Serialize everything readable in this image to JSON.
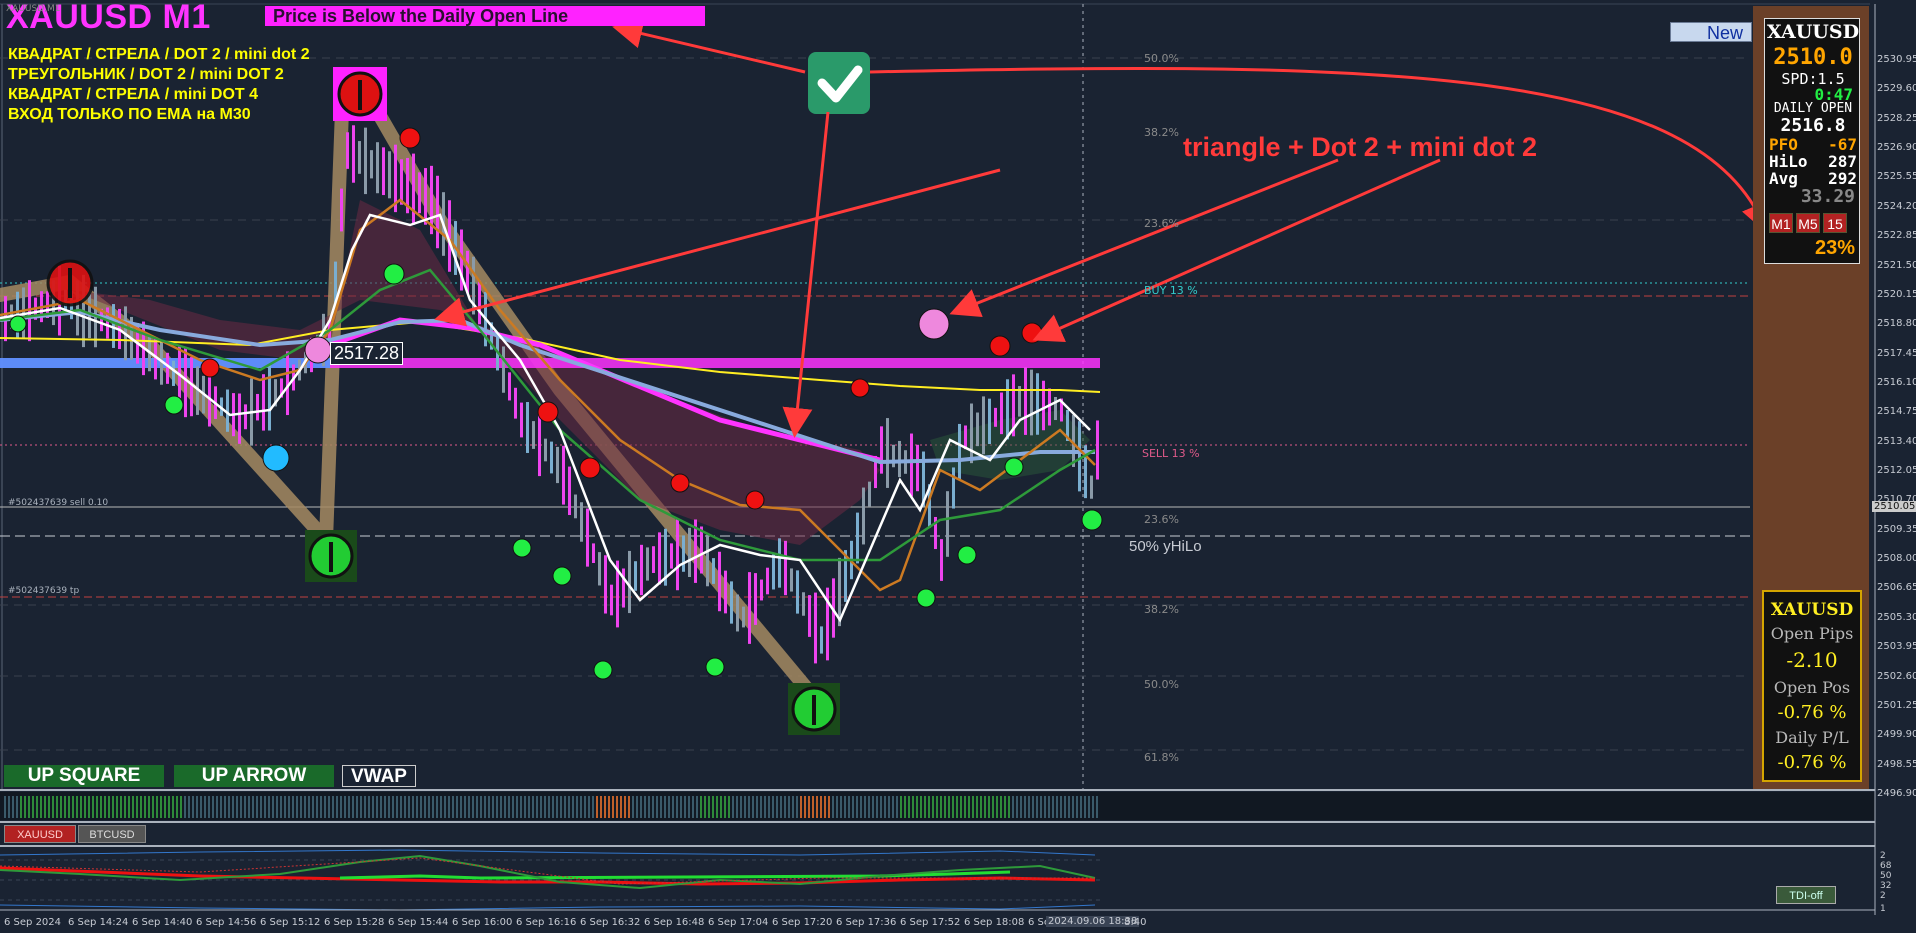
{
  "header": {
    "title": "XAUUSD M1",
    "banner": "Price is Below the Daily Open Line",
    "small_symbol": "XAUUSD,M1"
  },
  "notes": [
    "КВАДРАТ / СТРЕЛА / DOT 2 / mini dot 2",
    "ТРЕУГОЛЬНИК / DOT 2 / mini DOT 2",
    "КВАДРАТ / СТРЕЛА /  mini DOT 4",
    "ВХОД ТОЛЬКО ПО ЕМА на  M30"
  ],
  "annotation": "triangle + Dot 2 + mini dot 2",
  "new_button": "New",
  "current_price_tag": "2517.28",
  "order_labels": {
    "sell": "#502437639 sell 0.10",
    "tp": "#502437639 tp"
  },
  "levels": {
    "buy": "BUY 13 %",
    "sell": "SELL 13 %",
    "yhilo": "50% yHiLo"
  },
  "fib_labels": [
    "50.0%",
    "38.2%",
    "23.6%",
    "23.6%",
    "38.2%",
    "50.0%",
    "61.8%"
  ],
  "bottom_buttons": [
    "UP SQUARE",
    "UP ARROW",
    "VWAP"
  ],
  "info_panel": {
    "symbol": "XAUUSD",
    "price": "2510.0",
    "spread": "SPD:1.5",
    "timer": "0:47",
    "daily_open_label": "DAILY OPEN",
    "daily_open": "2516.8",
    "pfo_label": "PFO",
    "pfo": "-67",
    "hilo_label": "HiLo",
    "hilo": "287",
    "avg_label": "Avg",
    "avg": "292",
    "value": "33.29",
    "timeframes": [
      "M1",
      "M5",
      "15"
    ],
    "percent": "23%"
  },
  "position_panel": {
    "symbol": "XAUUSD",
    "open_pips_label": "Open Pips",
    "open_pips": "-2.10",
    "open_pos_label": "Open Pos",
    "open_pos": "-0.76 %",
    "daily_pl_label": "Daily P/L",
    "daily_pl": "-0.76 %"
  },
  "price_axis": [
    "2530.95",
    "2529.60",
    "2528.25",
    "2526.90",
    "2525.55",
    "2524.20",
    "2522.85",
    "2521.50",
    "2520.15",
    "2518.80",
    "2517.45",
    "2516.10",
    "2514.75",
    "2513.40",
    "2512.05",
    "2510.70",
    "2509.35",
    "2508.00",
    "2506.65",
    "2505.30",
    "2503.95",
    "2502.60",
    "2501.25",
    "2499.90",
    "2498.55",
    "2496.90"
  ],
  "current_axis_price": "2510.05",
  "indicator_axis": [
    "2",
    "68",
    "50",
    "32",
    "2",
    "1"
  ],
  "time_axis": [
    "6 Sep 2024",
    "6 Sep 14:24",
    "6 Sep 14:40",
    "6 Sep 14:56",
    "6 Sep 15:12",
    "6 Sep 15:28",
    "6 Sep 15:44",
    "6 Sep 16:00",
    "6 Sep 16:16",
    "6 Sep 16:32",
    "6 Sep 16:48",
    "6 Sep 17:04",
    "6 Sep 17:20",
    "6 Sep 17:36",
    "6 Sep 17:52",
    "6 Sep 18:08",
    "6 Sep"
  ],
  "time_cursor": "2024.09.06 18:38",
  "time_tail": "8:40",
  "symbol_tabs": [
    "XAUUSD",
    "BTCUSD"
  ],
  "tdi_button": "TDI-off",
  "colors": {
    "background": "#1a2332",
    "magenta": "#ff33ff",
    "yellow": "#ffff00",
    "red_annotation": "#ff3a3a",
    "panel": "#6b4028",
    "green_dot": "#22ee44",
    "red_dot": "#ee1111"
  }
}
